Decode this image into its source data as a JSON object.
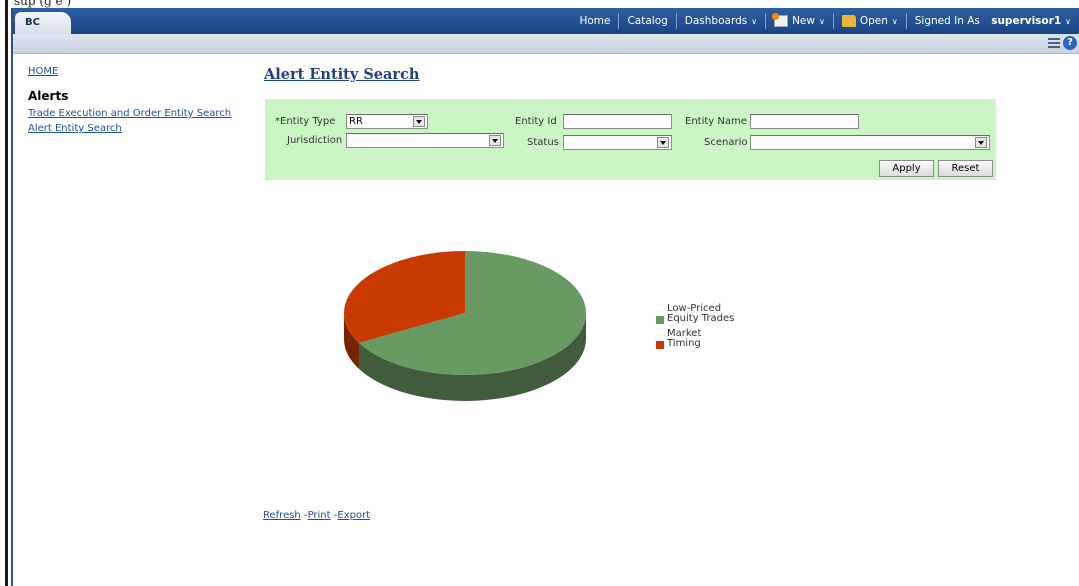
{
  "top_scrap": "sup  (g e  )",
  "header": {
    "brand": "BC",
    "nav": {
      "home": "Home",
      "catalog": "Catalog",
      "dashboards": "Dashboards",
      "new": "New",
      "open": "Open",
      "signed_in_as": "Signed In As",
      "user": "supervisor1"
    }
  },
  "sidebar": {
    "home": "HOME",
    "heading": "Alerts",
    "items": [
      "Trade Execution and Order Entity Search",
      "Alert Entity Search"
    ]
  },
  "main": {
    "title": "Alert Entity Search",
    "form": {
      "entity_type_label": "Entity Type",
      "required_mark": "*",
      "entity_type_value": "RR",
      "entity_id_label": "Entity Id",
      "entity_name_label": "Entity Name",
      "jurisdiction_label": "Jurisdiction",
      "status_label": "Status",
      "scenario_label": "Scenario",
      "apply": "Apply",
      "reset": "Reset"
    },
    "footer": {
      "refresh": "Refresh",
      "print": "Print",
      "export": "Export",
      "sep": "-"
    }
  },
  "chart_data": {
    "type": "pie",
    "categories": [
      "Low-Priced Equity Trades",
      "Market Timing"
    ],
    "values": [
      67,
      33
    ],
    "colors": [
      "#6a9a64",
      "#c83a00"
    ],
    "legend_position": "right"
  }
}
